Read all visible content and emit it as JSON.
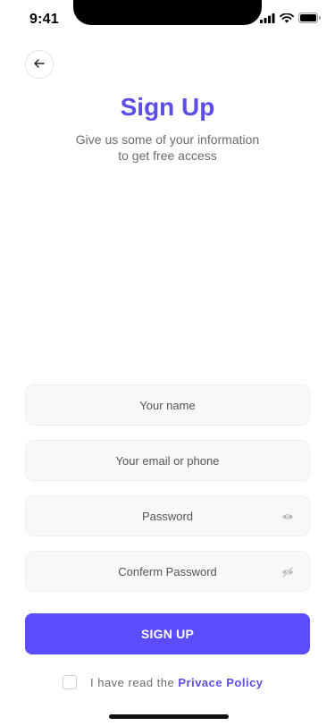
{
  "status_bar": {
    "time": "9:41",
    "icons": [
      "cellular-signal-icon",
      "wifi-icon",
      "battery-icon"
    ]
  },
  "back_button": {
    "icon": "arrow-left-icon"
  },
  "header": {
    "title": "Sign Up",
    "subtitle_line1": "Give us some of your information",
    "subtitle_line2": "to get free access"
  },
  "form": {
    "name": {
      "placeholder": "Your name",
      "value": ""
    },
    "email": {
      "placeholder": "Your email or phone",
      "value": ""
    },
    "password": {
      "placeholder": "Password",
      "value": "",
      "icon": "eye-icon"
    },
    "confirm_password": {
      "placeholder": "Conferm Password",
      "value": "",
      "icon": "eye-off-icon"
    },
    "submit_label": "SIGN UP"
  },
  "agreement": {
    "checked": false,
    "text": "I have read the",
    "link_text": "Privace Policy"
  },
  "colors": {
    "accent": "#5b4dfb",
    "title": "#5b4de8",
    "field_bg": "#f8f8f8",
    "muted_text": "#6b6b6b"
  }
}
